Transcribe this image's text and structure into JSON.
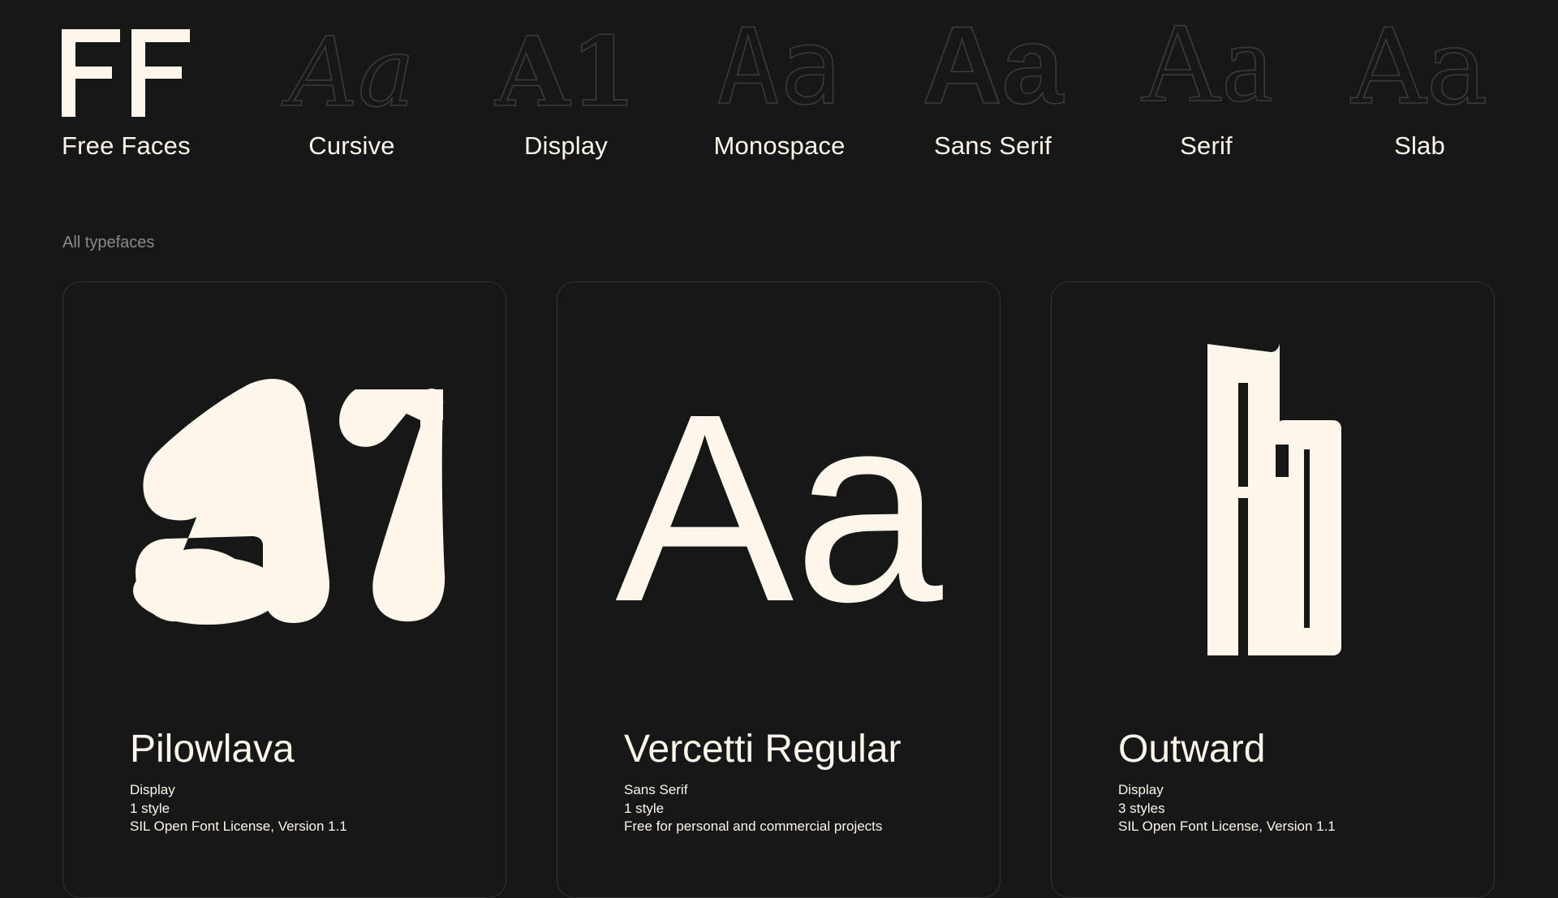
{
  "brand": {
    "mark": "FF",
    "label": "Free Faces"
  },
  "categories": [
    {
      "sample": "Aa",
      "label": "Cursive"
    },
    {
      "sample": "A1",
      "label": "Display"
    },
    {
      "sample": "Aa",
      "label": "Monospace"
    },
    {
      "sample": "Aa",
      "label": "Sans Serif"
    },
    {
      "sample": "Aa",
      "label": "Serif"
    },
    {
      "sample": "Aa",
      "label": "Slab"
    }
  ],
  "section_title": "All typefaces",
  "cards": [
    {
      "name": "Pilowlava",
      "category": "Display",
      "styles": "1 style",
      "license": "SIL Open Font License, Version 1.1"
    },
    {
      "name": "Vercetti Regular",
      "category": "Sans Serif",
      "styles": "1 style",
      "license": "Free for personal and commercial projects",
      "sample": "Aa"
    },
    {
      "name": "Outward",
      "category": "Display",
      "styles": "3 styles",
      "license": "SIL Open Font License, Version 1.1"
    }
  ],
  "colors": {
    "background": "#171717",
    "foreground": "#fdf6ea",
    "muted": "#8a8a8a",
    "outline": "#3b3b3b",
    "border": "#333333"
  },
  "icons": [
    "ff-logo",
    "cursive-glyph-icon",
    "display-glyph-icon",
    "monospace-glyph-icon",
    "sans-serif-glyph-icon",
    "serif-glyph-icon",
    "slab-glyph-icon"
  ]
}
